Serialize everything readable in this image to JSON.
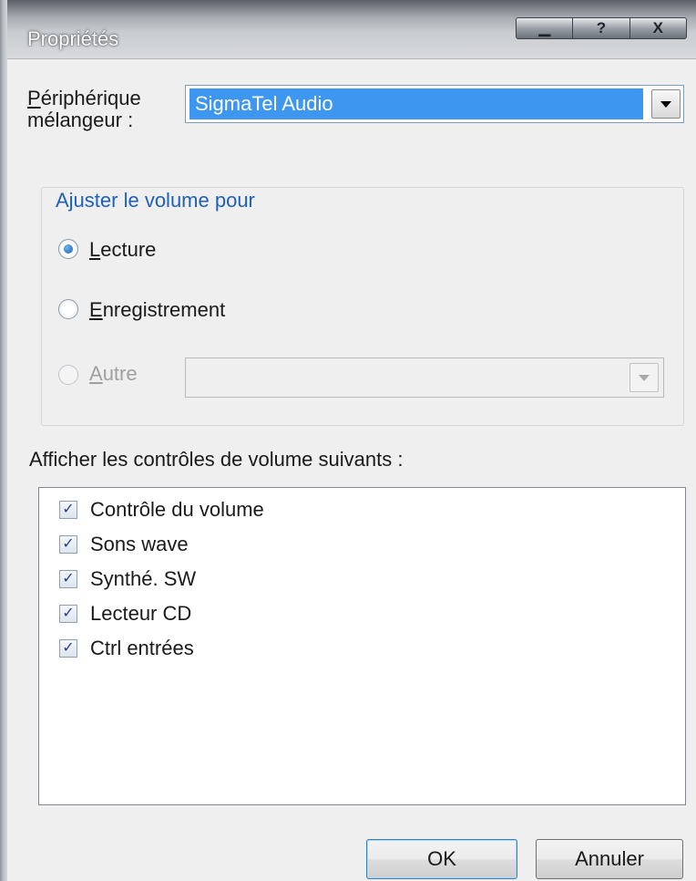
{
  "window": {
    "title": "Propriétés",
    "caption_buttons": [
      {
        "icon": "minimize-icon",
        "glyph": "▁"
      },
      {
        "icon": "help-icon",
        "glyph": "?"
      },
      {
        "icon": "close-icon",
        "glyph": "X"
      }
    ]
  },
  "device": {
    "label_line1": "Périphérique",
    "label_line2": "mélangeur :",
    "value": "SigmaTel Audio"
  },
  "volume_group": {
    "title": "Ajuster le volume pour",
    "options": [
      {
        "label": "Lecture",
        "selected": true,
        "enabled": true
      },
      {
        "label": "Enregistrement",
        "selected": false,
        "enabled": true
      },
      {
        "label": "Autre",
        "selected": false,
        "enabled": false
      }
    ],
    "other_value": ""
  },
  "controls": {
    "heading": "Afficher les contrôles de volume suivants :",
    "items": [
      {
        "label": "Contrôle du volume",
        "checked": true
      },
      {
        "label": "Sons wave",
        "checked": true
      },
      {
        "label": "Synthé. SW",
        "checked": true
      },
      {
        "label": "Lecteur CD",
        "checked": true
      },
      {
        "label": "Ctrl entrées",
        "checked": true
      }
    ]
  },
  "buttons": {
    "ok": "OK",
    "cancel": "Annuler"
  },
  "colors": {
    "selection": "#3d96f0",
    "group_title": "#1f5fbf",
    "dialog_bg": "#efefef"
  }
}
